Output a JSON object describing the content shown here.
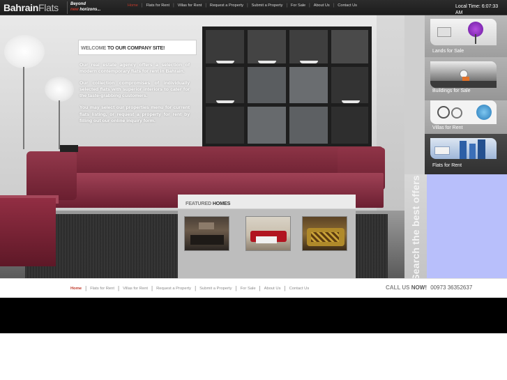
{
  "brand": {
    "logo_part1": "Bahrain",
    "logo_part2": "Flats",
    "tagline_line1": "Beyond",
    "tagline_accent": "new",
    "tagline_line2": "horizons..."
  },
  "top_nav": {
    "items": [
      {
        "label": "Home",
        "active": true
      },
      {
        "label": "Flats for Rent",
        "active": false
      },
      {
        "label": "Villas for Rent",
        "active": false
      },
      {
        "label": "Request a Property",
        "active": false
      },
      {
        "label": "Submit a Property",
        "active": false
      },
      {
        "label": "For Sale",
        "active": false
      },
      {
        "label": "About Us",
        "active": false
      },
      {
        "label": "Contact Us",
        "active": false
      }
    ],
    "separator": "|"
  },
  "local_time": {
    "label": "Local Time:",
    "value": "6:07:33 AM"
  },
  "welcome": {
    "title_prefix": "WELCOME",
    "title_rest": "TO OUR COMPANY SITE!",
    "paragraphs": [
      "Our real estate agency offers a selection of modern contemporary flats for rent in Bahrain.",
      "Our collection compromises of individually selected flats with superior interiors to cater for the taste-grabbing customers.",
      "You may select our properties menu for current flats listing, or request a property for rent by filling out our online inquiry form."
    ]
  },
  "featured": {
    "title_prefix": "FEATURED",
    "title_rest": "HOMES",
    "thumbnail_count": 3
  },
  "side_menu": {
    "items": [
      {
        "label": "Lands for Sale",
        "icon": "telescope-icon"
      },
      {
        "label": "Buildings for Sale",
        "icon": "golf-ball-icon"
      },
      {
        "label": "Villas for Rent",
        "icon": "cycle-icon"
      },
      {
        "label": "Flats for Rent",
        "icon": "towers-icon"
      }
    ],
    "vertical_text": "Search the best offers"
  },
  "bottom_nav": {
    "items": [
      {
        "label": "Home",
        "active": true
      },
      {
        "label": "Flats for Rent",
        "active": false
      },
      {
        "label": "Villas for Rent",
        "active": false
      },
      {
        "label": "Request a Property",
        "active": false
      },
      {
        "label": "Submit a Property",
        "active": false
      },
      {
        "label": "For Sale",
        "active": false
      },
      {
        "label": "About Us",
        "active": false
      },
      {
        "label": "Contact Us",
        "active": false
      }
    ],
    "separator": "|"
  },
  "call_us": {
    "prefix": "CALL US",
    "emphasis": "NOW!",
    "number": "00973 36352637"
  },
  "colors": {
    "accent": "#c0392b",
    "topbar": "#222222",
    "sofa": "#8d3446",
    "side_blue": "#b8bffb"
  }
}
